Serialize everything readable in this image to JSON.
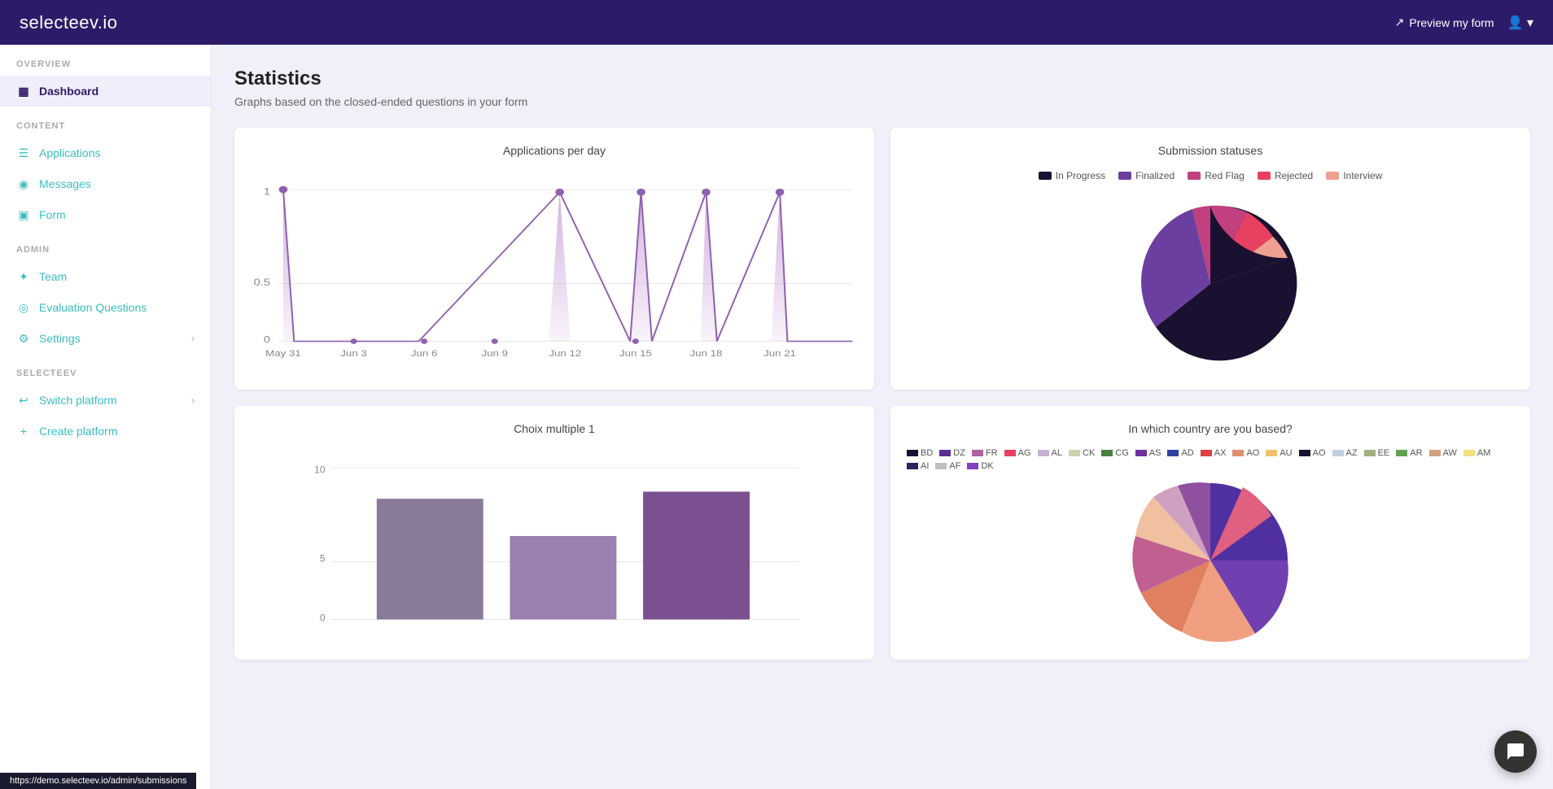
{
  "topnav": {
    "logo": "selecteev.io",
    "preview_link": "Preview my form",
    "preview_icon": "↗"
  },
  "sidebar": {
    "overview_label": "OVERVIEW",
    "dashboard_label": "Dashboard",
    "content_label": "CONTENT",
    "applications_label": "Applications",
    "messages_label": "Messages",
    "form_label": "Form",
    "admin_label": "ADMIN",
    "team_label": "Team",
    "evaluation_label": "Evaluation Questions",
    "settings_label": "Settings",
    "selecteev_label": "SELECTEEV",
    "switch_platform_label": "Switch platform",
    "create_platform_label": "Create platform"
  },
  "main": {
    "page_title": "Statistics",
    "page_subtitle": "Graphs based on the closed-ended questions in your form"
  },
  "chart1": {
    "title": "Applications per day",
    "x_labels": [
      "May 31",
      "Jun 3",
      "Jun 6",
      "Jun 9",
      "Jun 12",
      "Jun 15",
      "Jun 18",
      "Jun 21"
    ],
    "y_labels": [
      "0",
      "0.5",
      "1"
    ]
  },
  "chart2": {
    "title": "Submission statuses",
    "legend": [
      {
        "label": "In Progress",
        "color": "#1a1030"
      },
      {
        "label": "Finalized",
        "color": "#6b3fa0"
      },
      {
        "label": "Red Flag",
        "color": "#c04080"
      },
      {
        "label": "Rejected",
        "color": "#e84060"
      },
      {
        "label": "Interview",
        "color": "#f0a090"
      }
    ]
  },
  "chart3": {
    "title": "Choix multiple 1",
    "y_labels": [
      "0",
      "5",
      "10"
    ],
    "bars": [
      {
        "color": "#8a7a9a",
        "height": 0.7
      },
      {
        "color": "#9a80b0",
        "height": 0.55
      },
      {
        "color": "#7a5090",
        "height": 0.75
      }
    ]
  },
  "chart4": {
    "title": "In which country are you based?",
    "legend_row1": [
      "BD",
      "DZ",
      "FR",
      "AG",
      "AL",
      "CK",
      "CG",
      "AS",
      "AD"
    ],
    "legend_row2": [
      "AX",
      "AO",
      "AU",
      "AO",
      "AZ",
      "EE",
      "AR",
      "AW",
      "AM"
    ],
    "legend_row3": [
      "AI",
      "AF",
      "DK"
    ]
  },
  "status_bar": {
    "url": "https://demo.selecteev.io/admin/submissions"
  },
  "chat_icon": "💬"
}
